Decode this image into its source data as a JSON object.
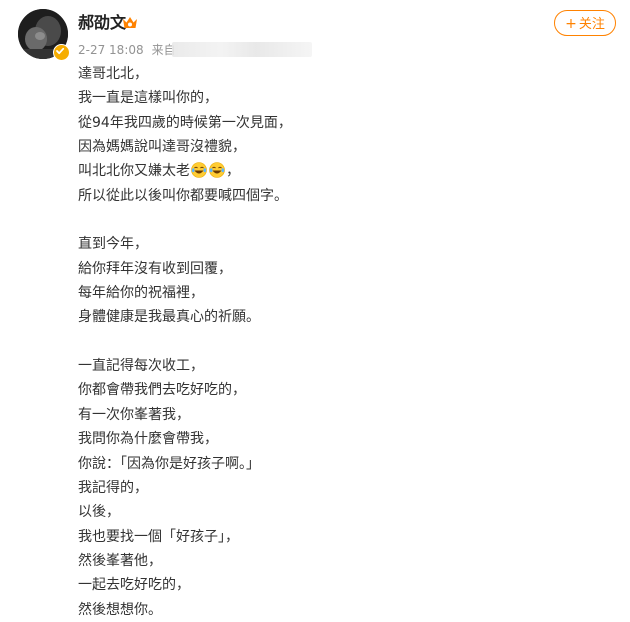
{
  "user": {
    "name": "郝劭文",
    "follow_label": "关注",
    "follow_plus": "+"
  },
  "meta": {
    "timestamp": "2-27 18:08",
    "source_label": "来自"
  },
  "post": {
    "paragraphs": [
      [
        "達哥北北，",
        "我一直是這樣叫你的，",
        "從94年我四歲的時候第一次見面，",
        "因為媽媽說叫達哥沒禮貌，"
      ],
      [
        "直到今年，",
        "給你拜年沒有收到回覆，",
        "每年給你的祝福裡，",
        "身體健康是我最真心的祈願。"
      ],
      [
        "一直記得每次收工，",
        "你都會帶我們去吃好吃的，",
        "有一次你峯著我，",
        "我問你為什麼會帶我，",
        "你說：「因為你是好孩子啊。」",
        "我記得的，",
        "以後，",
        "我也要找一個「好孩子」，",
        "然後峯著他，",
        "一起去吃好吃的，",
        "然後想想你。"
      ]
    ],
    "emoji_line_prefix": "叫北北你又嫌太老",
    "emoji_line_suffix": "，",
    "emoji_name": "laugh-cry-icon",
    "after_emoji_line": "所以從此以後叫你都要喊四個字。"
  },
  "colors": {
    "accent": "#ff8200",
    "verified": "#f6ad00",
    "meta_text": "#939393",
    "body_text": "#333333"
  }
}
